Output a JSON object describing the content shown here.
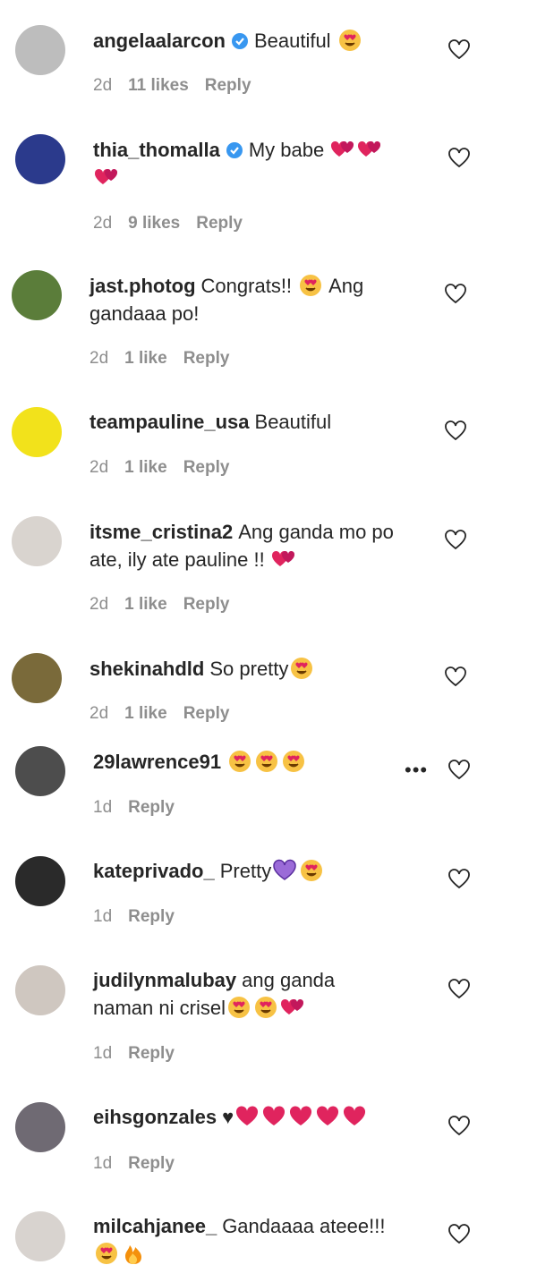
{
  "comments": [
    {
      "user": "angelaalarcon",
      "verified": true,
      "text": "Beautiful",
      "emojis": [
        "heart-eyes"
      ],
      "time": "2d",
      "likes": "11 likes",
      "reply": "Reply",
      "avatar_color": "#bdbdbd"
    },
    {
      "user": "thia_thomalla",
      "verified": true,
      "text": "My babe",
      "emojis": [
        "two-hearts",
        "two-hearts",
        "two-hearts"
      ],
      "time": "2d",
      "likes": "9 likes",
      "reply": "Reply",
      "avatar_color": "#2b3a8c"
    },
    {
      "user": "jast.photog",
      "verified": false,
      "text": "Congrats!!",
      "text2": "Ang gandaaa po!",
      "emojis": [
        "heart-eyes"
      ],
      "time": "2d",
      "likes": "1 like",
      "reply": "Reply",
      "avatar_color": "#5b7d3a"
    },
    {
      "user": "teampauline_usa",
      "verified": false,
      "text": "Beautiful",
      "emojis": [],
      "time": "2d",
      "likes": "1 like",
      "reply": "Reply",
      "avatar_color": "#f2e21b"
    },
    {
      "user": "itsme_cristina2",
      "verified": false,
      "text": "Ang ganda mo po ate, ily ate pauline !!",
      "emojis": [
        "two-hearts"
      ],
      "time": "2d",
      "likes": "1 like",
      "reply": "Reply",
      "avatar_color": "#d9d4cf"
    },
    {
      "user": "shekinahdld",
      "verified": false,
      "text": "So pretty",
      "emojis": [
        "heart-eyes"
      ],
      "time": "2d",
      "likes": "1 like",
      "reply": "Reply",
      "avatar_color": "#7a6a3a"
    },
    {
      "user": "29lawrence91",
      "verified": false,
      "text": "",
      "emojis": [
        "heart-eyes",
        "heart-eyes",
        "heart-eyes"
      ],
      "time": "1d",
      "likes": "",
      "reply": "Reply",
      "avatar_color": "#4d4d4d",
      "more": "•••"
    },
    {
      "user": "kateprivado_",
      "verified": false,
      "text": "Pretty",
      "emojis": [
        "purple-heart",
        "heart-eyes"
      ],
      "time": "1d",
      "likes": "",
      "reply": "Reply",
      "avatar_color": "#2a2a2a"
    },
    {
      "user": "judilynmalubay",
      "verified": false,
      "text": "ang ganda naman ni crisel",
      "emojis": [
        "heart-eyes",
        "heart-eyes",
        "two-hearts"
      ],
      "time": "1d",
      "likes": "",
      "reply": "Reply",
      "avatar_color": "#cfc7c0"
    },
    {
      "user": "eihsgonzales",
      "verified": false,
      "text": "♥",
      "emojis": [
        "red-heart",
        "red-heart",
        "red-heart",
        "red-heart",
        "red-heart"
      ],
      "time": "1d",
      "likes": "",
      "reply": "Reply",
      "avatar_color": "#6f6a73"
    },
    {
      "user": "milcahjanee_",
      "verified": false,
      "text": "Gandaaaa ateee!!!",
      "emojis": [
        "heart-eyes",
        "fire"
      ],
      "time": "",
      "likes": "",
      "reply": "",
      "avatar_color": "#d8d3cf"
    }
  ],
  "colors": {
    "verified": "#3897f0",
    "meta": "#8e8e8e",
    "text": "#262626",
    "heart_red": "#e0245e",
    "emoji_yellow": "#f7c244"
  }
}
